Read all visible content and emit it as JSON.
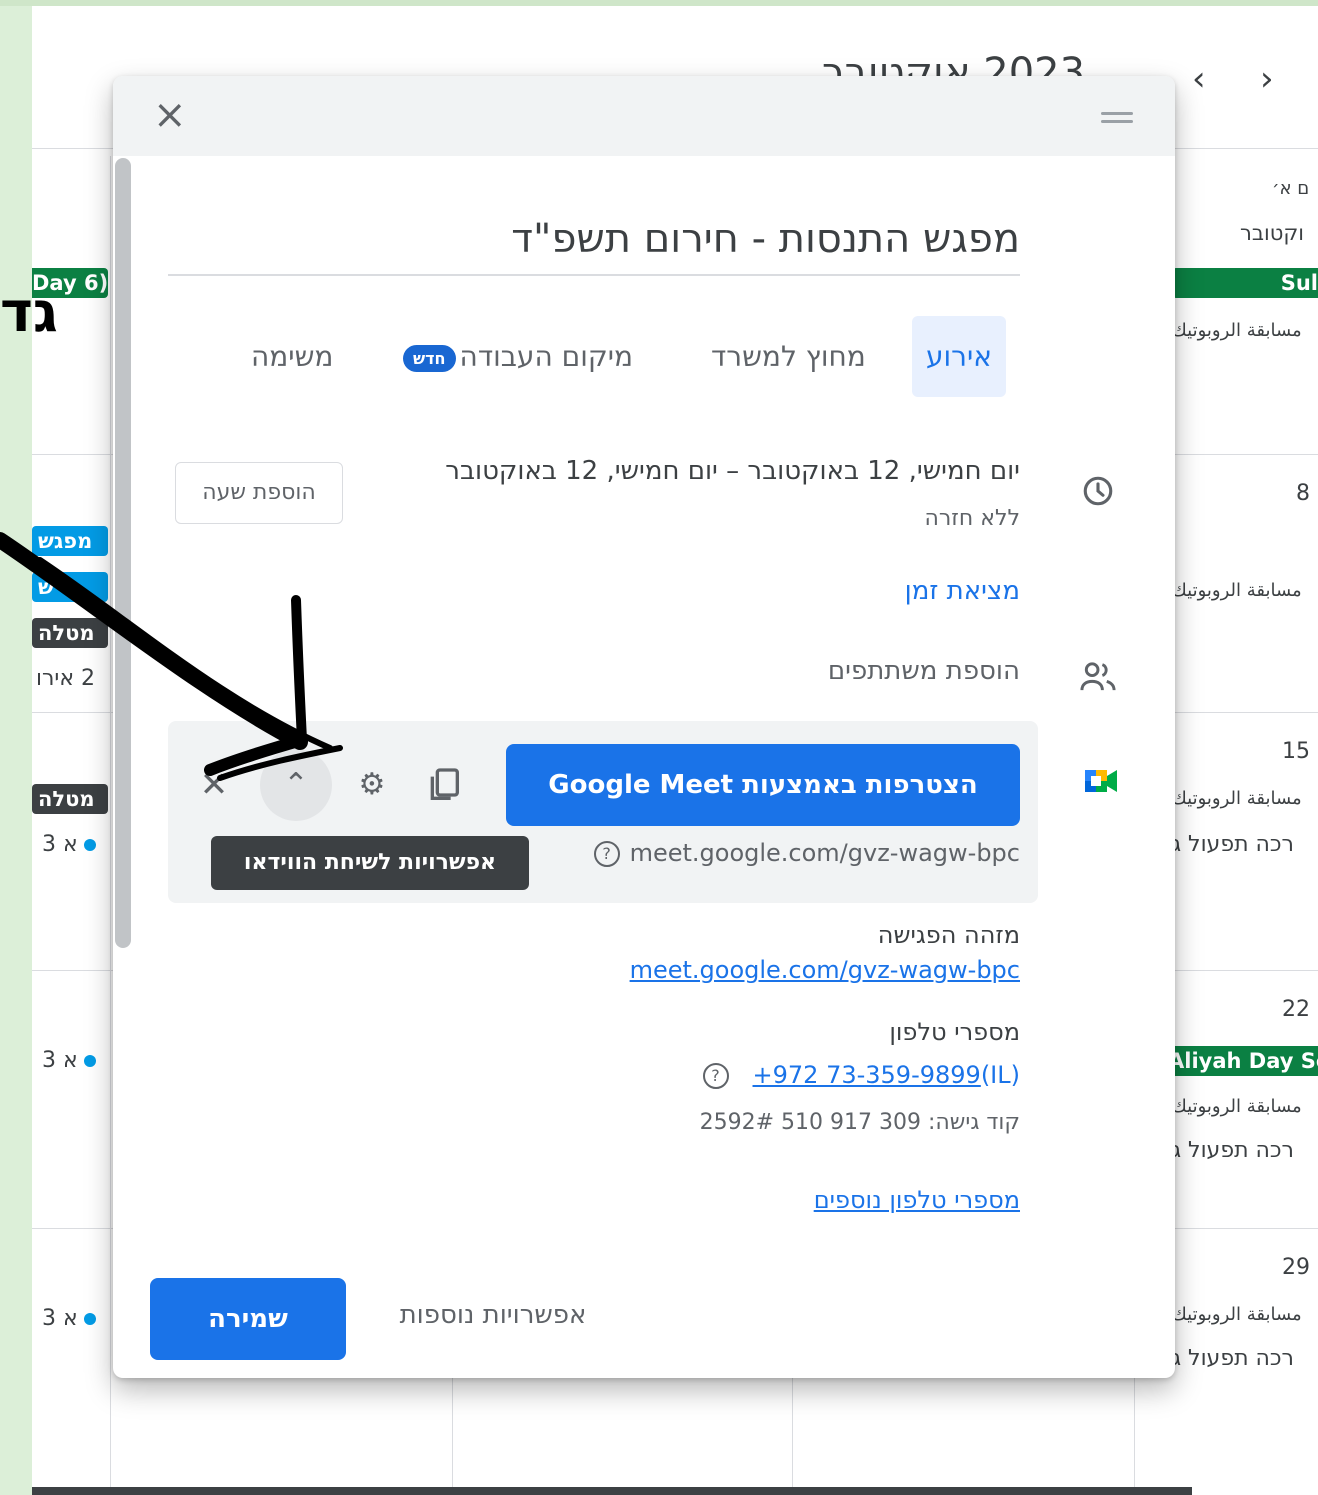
{
  "calendar": {
    "month_title": "2023 אוקטובר",
    "nav_prev": "‹",
    "nav_next": "›",
    "day_label": "ם א׳",
    "month_label": "וקטובר",
    "holiday_chip_right": "Sul",
    "holiday_chip_left": "Day 6)",
    "event_robotics": "مسابقة الروبوتيك",
    "dates": [
      "8",
      "15",
      "22",
      "29"
    ],
    "chip_aliyah": "Aliyah Day Sc",
    "event_prayer": "רכה תפעול ג",
    "left_chips": [
      "מפגש",
      "ש",
      "מטלה"
    ],
    "left_more": "2 אירו",
    "left_chip_task2": "מטלה",
    "left_dot_rows": [
      "3 א",
      "3 א",
      "3 א"
    ]
  },
  "annotation": {
    "text": "גד"
  },
  "dialog": {
    "title": "מפגש התנסות - חירום תשפ\"ד",
    "close_icon": "×",
    "tabs": {
      "event": "אירוע",
      "out_of_office": "מחוץ למשרד",
      "working_location": "מיקום העבודה",
      "new_badge": "חדש",
      "task": "משימה"
    },
    "date_range": "יום חמישי, 12 באוקטובר  –  יום חמישי, 12 באוקטובר",
    "repeat": "ללא חזרה",
    "add_time_button": "הוספת שעה",
    "find_time": "מציאת זמן",
    "add_guests": "הוספת משתתפים",
    "meet": {
      "join_button": "הצטרפות באמצעות Google Meet",
      "link": "meet.google.com/gvz-wagw-bpc",
      "tooltip": "אפשרויות לשיחת הווידאו"
    },
    "meeting_id_label": "מזהה הפגישה",
    "meeting_id_link": "meet.google.com/gvz-wagw-bpc",
    "phone_label": "מספרי טלפון",
    "phone_number": "+972 73-359-9899",
    "phone_country": "(IL)",
    "access_code": "קוד גישה: 309 917 510 2592#",
    "more_phones": "מספרי טלפון נוספים",
    "more_options": "אפשרויות נוספות",
    "save_button": "שמירה"
  },
  "colors": {
    "accent": "#1a73e8",
    "frame_background": "#dcefd8",
    "holiday_green": "#0b8043",
    "event_blue": "#039be5"
  }
}
